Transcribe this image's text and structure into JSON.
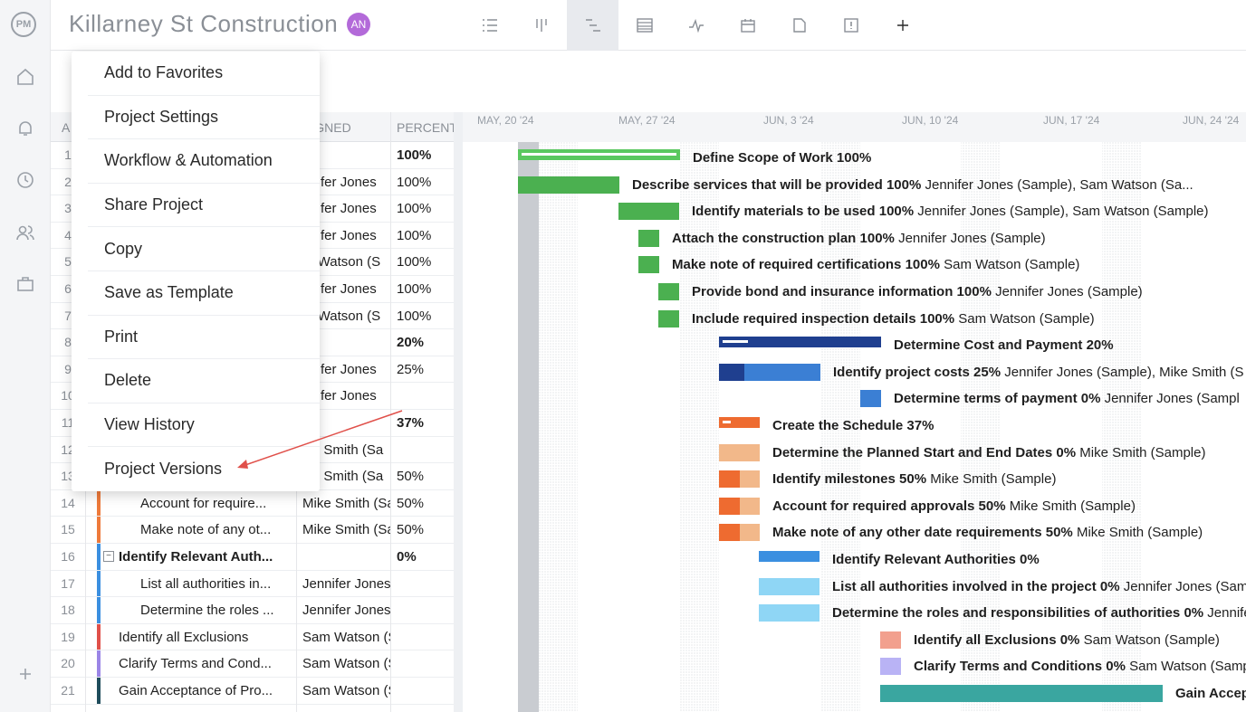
{
  "app": {
    "logo": "PM",
    "title": "Killarney St Construction",
    "avatar": "AN"
  },
  "sidebar": {
    "icons": [
      "home-icon",
      "bell-icon",
      "clock-icon",
      "people-icon",
      "briefcase-icon",
      "plus-icon"
    ]
  },
  "view_tabs": [
    "list-view-icon",
    "board-view-icon",
    "gantt-view-icon",
    "sheet-view-icon",
    "dashboard-view-icon",
    "calendar-view-icon",
    "doc-view-icon",
    "report-view-icon",
    "add-view-icon"
  ],
  "grid": {
    "headers": {
      "id": "A",
      "assigned": "SIGNED",
      "percent": "PERCENT"
    },
    "rows": [
      {
        "num": "1",
        "task": "",
        "assigned": "",
        "pct": "100%",
        "bold": true,
        "color": "#5ac85f"
      },
      {
        "num": "2",
        "task": "",
        "assigned": "nnifer Jones",
        "pct": "100%",
        "bold": false,
        "color": "#5ac85f"
      },
      {
        "num": "3",
        "task": "",
        "assigned": "nnifer Jones",
        "pct": "100%",
        "bold": false,
        "color": "#5ac85f"
      },
      {
        "num": "4",
        "task": "",
        "assigned": "nnifer Jones",
        "pct": "100%",
        "bold": false,
        "color": "#5ac85f"
      },
      {
        "num": "5",
        "task": "",
        "assigned": "m Watson (S",
        "pct": "100%",
        "bold": false,
        "color": "#5ac85f"
      },
      {
        "num": "6",
        "task": "",
        "assigned": "nnifer Jones",
        "pct": "100%",
        "bold": false,
        "color": "#5ac85f"
      },
      {
        "num": "7",
        "task": "",
        "assigned": "m Watson (S",
        "pct": "100%",
        "bold": false,
        "color": "#5ac85f"
      },
      {
        "num": "8",
        "task": "",
        "assigned": "",
        "pct": "20%",
        "bold": true,
        "color": "#2a5db0"
      },
      {
        "num": "9",
        "task": "",
        "assigned": "nnifer Jones",
        "pct": "25%",
        "bold": false,
        "color": "#2a5db0"
      },
      {
        "num": "10",
        "task": "",
        "assigned": "nnifer Jones",
        "pct": "",
        "bold": false,
        "color": "#2a5db0"
      },
      {
        "num": "11",
        "task": "",
        "assigned": "",
        "pct": "37%",
        "bold": true,
        "color": "#ee7a3b"
      },
      {
        "num": "12",
        "task": "",
        "assigned": "ike Smith (Sa",
        "pct": "",
        "bold": false,
        "color": "#ee7a3b"
      },
      {
        "num": "13",
        "task": "",
        "assigned": "ike Smith (Sa",
        "pct": "50%",
        "bold": false,
        "color": "#ee7a3b"
      },
      {
        "num": "14",
        "task": "Account for require...",
        "assigned": "Mike Smith (Sa",
        "pct": "50%",
        "bold": false,
        "color": "#ee7a3b",
        "indent": 2
      },
      {
        "num": "15",
        "task": "Make note of any ot...",
        "assigned": "Mike Smith (Sa",
        "pct": "50%",
        "bold": false,
        "color": "#ee7a3b",
        "indent": 2
      },
      {
        "num": "16",
        "task": "Identify Relevant Auth...",
        "assigned": "",
        "pct": "0%",
        "bold": true,
        "color": "#3b8fe0",
        "indent": 1,
        "collapse": "−"
      },
      {
        "num": "17",
        "task": "List all authorities in...",
        "assigned": "Jennifer Jones",
        "pct": "",
        "bold": false,
        "color": "#3b8fe0",
        "indent": 2
      },
      {
        "num": "18",
        "task": "Determine the roles ...",
        "assigned": "Jennifer Jones",
        "pct": "",
        "bold": false,
        "color": "#3b8fe0",
        "indent": 2
      },
      {
        "num": "19",
        "task": "Identify all Exclusions",
        "assigned": "Sam Watson (S",
        "pct": "",
        "bold": false,
        "color": "#e0504a",
        "indent": 1
      },
      {
        "num": "20",
        "task": "Clarify Terms and Cond...",
        "assigned": "Sam Watson (S",
        "pct": "",
        "bold": false,
        "color": "#9b85e6",
        "indent": 1
      },
      {
        "num": "21",
        "task": "Gain Acceptance of Pro...",
        "assigned": "Sam Watson (S",
        "pct": "",
        "bold": false,
        "color": "#1f4d5c",
        "indent": 1
      }
    ]
  },
  "gantt": {
    "dates": [
      "MAY, 20 '24",
      "MAY, 27 '24",
      "JUN, 3 '24",
      "JUN, 10 '24",
      "JUN, 17 '24",
      "JUN, 24 '24"
    ],
    "bars": [
      {
        "label": "Define Scope of Work",
        "pct": "100%",
        "who": "",
        "color": "#5ac85f",
        "summary": true
      },
      {
        "label": "Describe services that will be provided",
        "pct": "100%",
        "who": "Jennifer Jones (Sample), Sam Watson (Sa...",
        "color": "#5ac85f",
        "summary": false
      },
      {
        "label": "Identify materials to be used",
        "pct": "100%",
        "who": "Jennifer Jones (Sample), Sam Watson (Sample)",
        "color": "#5ac85f",
        "summary": false
      },
      {
        "label": "Attach the construction plan",
        "pct": "100%",
        "who": "Jennifer Jones (Sample)",
        "color": "#5ac85f",
        "summary": false
      },
      {
        "label": "Make note of required certifications",
        "pct": "100%",
        "who": "Sam Watson (Sample)",
        "color": "#5ac85f",
        "summary": false
      },
      {
        "label": "Provide bond and insurance information",
        "pct": "100%",
        "who": "Jennifer Jones (Sample)",
        "color": "#5ac85f",
        "summary": false
      },
      {
        "label": "Include required inspection details",
        "pct": "100%",
        "who": "Sam Watson (Sample)",
        "color": "#5ac85f",
        "summary": false
      },
      {
        "label": "Determine Cost and Payment",
        "pct": "20%",
        "who": "",
        "color": "#1f3f8f",
        "summary": true
      },
      {
        "label": "Identify project costs",
        "pct": "25%",
        "who": "Jennifer Jones (Sample), Mike Smith (S",
        "color": "#3b7fd4",
        "summary": false
      },
      {
        "label": "Determine terms of payment",
        "pct": "0%",
        "who": "Jennifer Jones (Sampl",
        "color": "#3b7fd4",
        "summary": false
      },
      {
        "label": "Create the Schedule",
        "pct": "37%",
        "who": "",
        "color": "#ee6b30",
        "summary": true
      },
      {
        "label": "Determine the Planned Start and End Dates",
        "pct": "0%",
        "who": "Mike Smith (Sample)",
        "color": "#f2b88a",
        "summary": false
      },
      {
        "label": "Identify milestones",
        "pct": "50%",
        "who": "Mike Smith (Sample)",
        "color": "#f2b88a",
        "summary": false
      },
      {
        "label": "Account for required approvals",
        "pct": "50%",
        "who": "Mike Smith (Sample)",
        "color": "#f2b88a",
        "summary": false
      },
      {
        "label": "Make note of any other date requirements",
        "pct": "50%",
        "who": "Mike Smith (Sample)",
        "color": "#f2b88a",
        "summary": false
      },
      {
        "label": "Identify Relevant Authorities",
        "pct": "0%",
        "who": "",
        "color": "#3b8fe0",
        "summary": true
      },
      {
        "label": "List all authorities involved in the project",
        "pct": "0%",
        "who": "Jennifer Jones (Sam",
        "color": "#8fd6f5",
        "summary": false
      },
      {
        "label": "Determine the roles and responsibilities of authorities",
        "pct": "0%",
        "who": "Jennife",
        "color": "#8fd6f5",
        "summary": false
      },
      {
        "label": "Identify all Exclusions",
        "pct": "0%",
        "who": "Sam Watson (Sample)",
        "color": "#f2a08e",
        "summary": false
      },
      {
        "label": "Clarify Terms and Conditions",
        "pct": "0%",
        "who": "Sam Watson (Samp",
        "color": "#b9b3f5",
        "summary": false
      },
      {
        "label": "Gain Accep",
        "pct": "",
        "who": "",
        "color": "#3aa6a0",
        "summary": false
      }
    ]
  },
  "menu": {
    "items": [
      "Add to Favorites",
      "Project Settings",
      "Workflow & Automation",
      "Share Project",
      "Copy",
      "Save as Template",
      "Print",
      "Delete",
      "View History",
      "Project Versions"
    ]
  }
}
